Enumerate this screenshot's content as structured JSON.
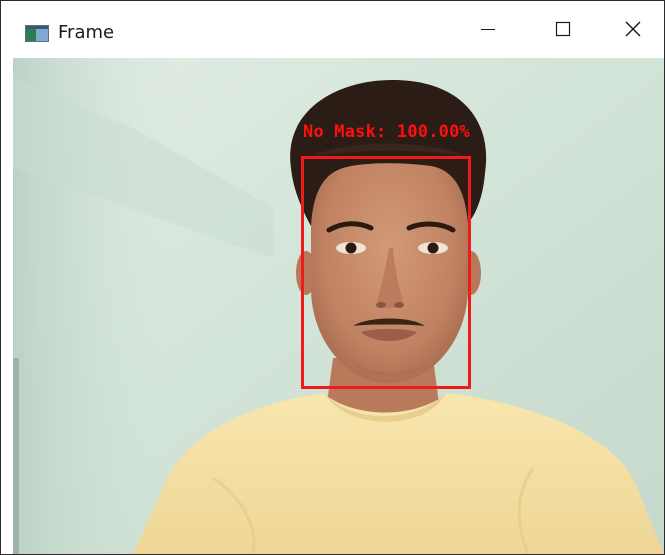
{
  "window": {
    "title": "Frame",
    "icon": "opencv-frame-window-icon",
    "controls": [
      "minimize-icon",
      "maximize-icon",
      "close-icon"
    ]
  },
  "detection": {
    "label": "No Mask: 100.00%",
    "box_color": "#ee1b1b"
  },
  "colors": {
    "wall": "#d3e4d8",
    "shirt": "#f6e1a4",
    "skin": "#c98a68",
    "hair": "#2b1c15"
  }
}
